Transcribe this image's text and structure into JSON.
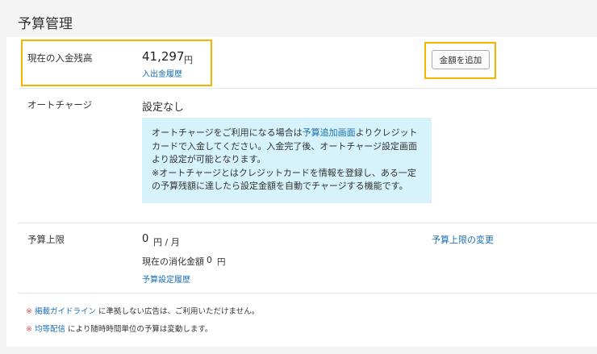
{
  "page": {
    "title": "予算管理"
  },
  "balance": {
    "label": "現在の入金残高",
    "amount": "41,297",
    "unit": "円",
    "history_link": "入出金履歴",
    "add_button": "金額を追加"
  },
  "auto_charge": {
    "label": "オートチャージ",
    "status": "設定なし",
    "info_pre": "オートチャージをご利用になる場合は",
    "info_link": "予算追加画面",
    "info_mid": "よりクレジットカードで入金してください。入金完了後、オートチャージ設定画面より設定が可能となります。",
    "info_note": "※オートチャージとはクレジットカードを情報を登録し、ある一定の予算残額に達したら設定金額を自動でチャージする機能です。"
  },
  "budget_limit": {
    "label": "予算上限",
    "amount": "0",
    "unit": "円 / 月",
    "change_link": "予算上限の変更",
    "consumed_label": "現在の消化金額",
    "consumed_amount": "0",
    "consumed_unit": "円",
    "history_link": "予算設定履歴"
  },
  "notes": [
    {
      "mark": "※",
      "link": "掲載ガイドライン",
      "text": "に準拠しない広告は、ご利用いただけません。"
    },
    {
      "mark": "※",
      "link": "均等配信",
      "text": "により随時時間単位の予算は変動します。"
    }
  ],
  "colors": {
    "highlight": "#f5b400",
    "link": "#1a6fb3",
    "info_bg": "#d6f2fb"
  }
}
